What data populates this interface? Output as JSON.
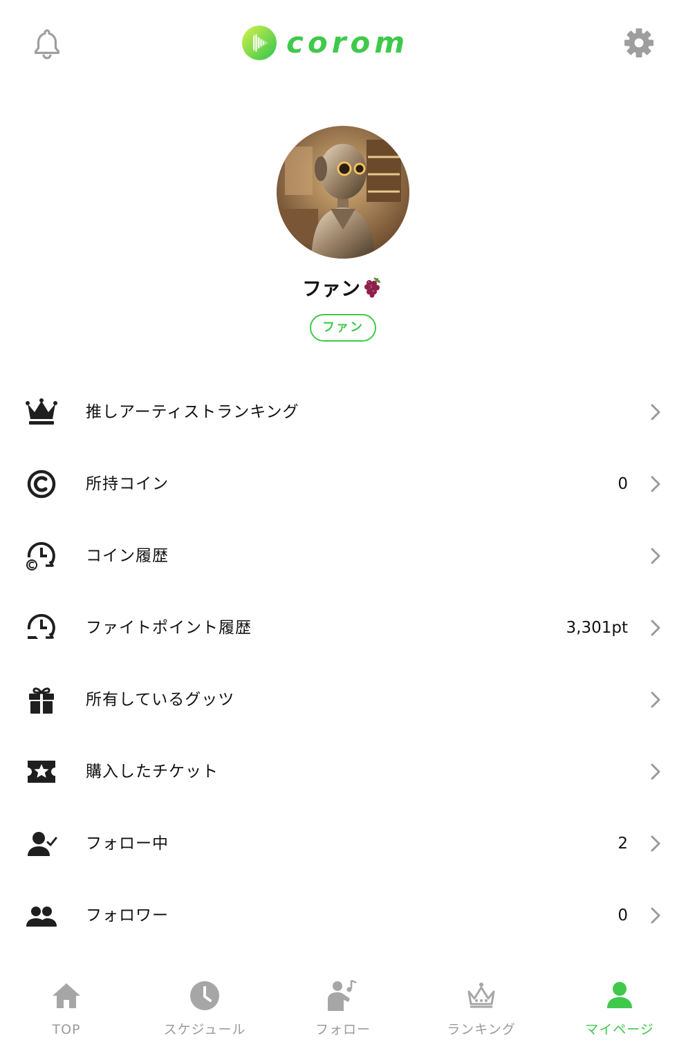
{
  "header": {
    "logo_text": "corom",
    "bell_icon": "bell-icon",
    "settings_icon": "gear-icon",
    "brand_color": "#3fc94b"
  },
  "profile": {
    "name": "ファン",
    "name_emoji_icon": "grape-icon",
    "role_badge": "ファン",
    "avatar_icon": "robot-avatar"
  },
  "menu": [
    {
      "icon": "crown-icon",
      "label": "推しアーティストランキング",
      "value": ""
    },
    {
      "icon": "coin-icon",
      "label": "所持コイン",
      "value": "0"
    },
    {
      "icon": "coin-history-icon",
      "label": "コイン履歴",
      "value": ""
    },
    {
      "icon": "point-history-icon",
      "label": "ファイトポイント履歴",
      "value": "3,301pt"
    },
    {
      "icon": "gift-icon",
      "label": "所有しているグッツ",
      "value": ""
    },
    {
      "icon": "ticket-icon",
      "label": "購入したチケット",
      "value": ""
    },
    {
      "icon": "person-check-icon",
      "label": "フォロー中",
      "value": "2"
    },
    {
      "icon": "group-icon",
      "label": "フォロワー",
      "value": "0"
    }
  ],
  "tabbar": {
    "items": [
      {
        "icon": "home-icon",
        "label": "TOP",
        "active": false
      },
      {
        "icon": "clock-icon",
        "label": "スケジュール",
        "active": false
      },
      {
        "icon": "follow-music-icon",
        "label": "フォロー",
        "active": false
      },
      {
        "icon": "crown-ranking-icon",
        "label": "ランキング",
        "active": false
      },
      {
        "icon": "person-icon",
        "label": "マイページ",
        "active": true
      }
    ],
    "active_color": "#3fc94b",
    "inactive_color": "#9a9a9a"
  }
}
